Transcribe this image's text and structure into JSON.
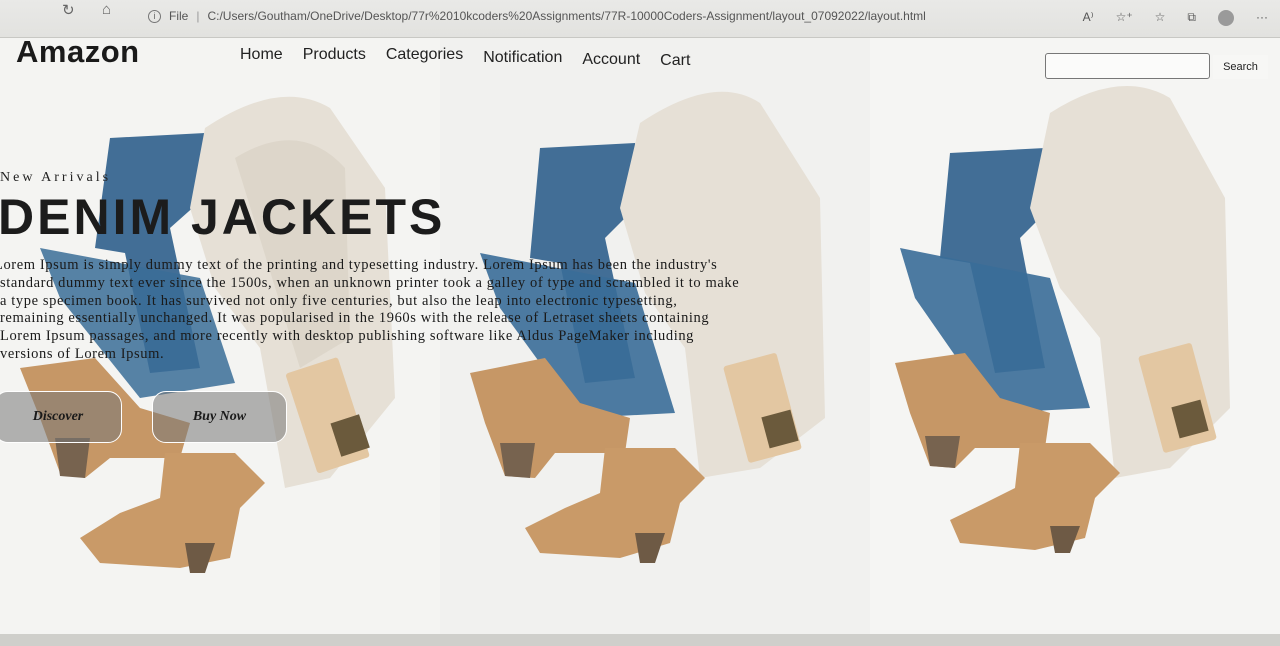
{
  "browser": {
    "file_label": "File",
    "separator": "|",
    "url": "C:/Users/Goutham/OneDrive/Desktop/77r%2010kcoders%20Assignments/77R-10000Coders-Assignment/layout_07092022/layout.html",
    "more_label": "···"
  },
  "header": {
    "logo": "Amazon",
    "nav": [
      "Home",
      "Products",
      "Categories",
      "Notification",
      "Account",
      "Cart"
    ],
    "search_placeholder": "",
    "search_button": "Search"
  },
  "hero": {
    "eyebrow": "New Arrivals",
    "headline": "DENIM JACKETS",
    "body": "Lorem Ipsum is simply dummy text of the printing and typesetting industry. Lorem Ipsum has been the industry's standard dummy text ever since the 1500s, when an unknown printer took a galley of type and scrambled it to make a type specimen book. It has survived not only five centuries, but also the leap into electronic typesetting, remaining essentially unchanged. It was popularised in the 1960s with the release of Letraset sheets containing Lorem Ipsum passages, and more recently with desktop publishing software like Aldus PageMaker including versions of Lorem Ipsum.",
    "buttons": {
      "discover": "Discover",
      "buy": "Buy Now"
    }
  },
  "colors": {
    "denim": "#2e5f8a",
    "knit": "#e3ddd2",
    "boot": "#c99a68",
    "background": "#f3f3f1"
  }
}
